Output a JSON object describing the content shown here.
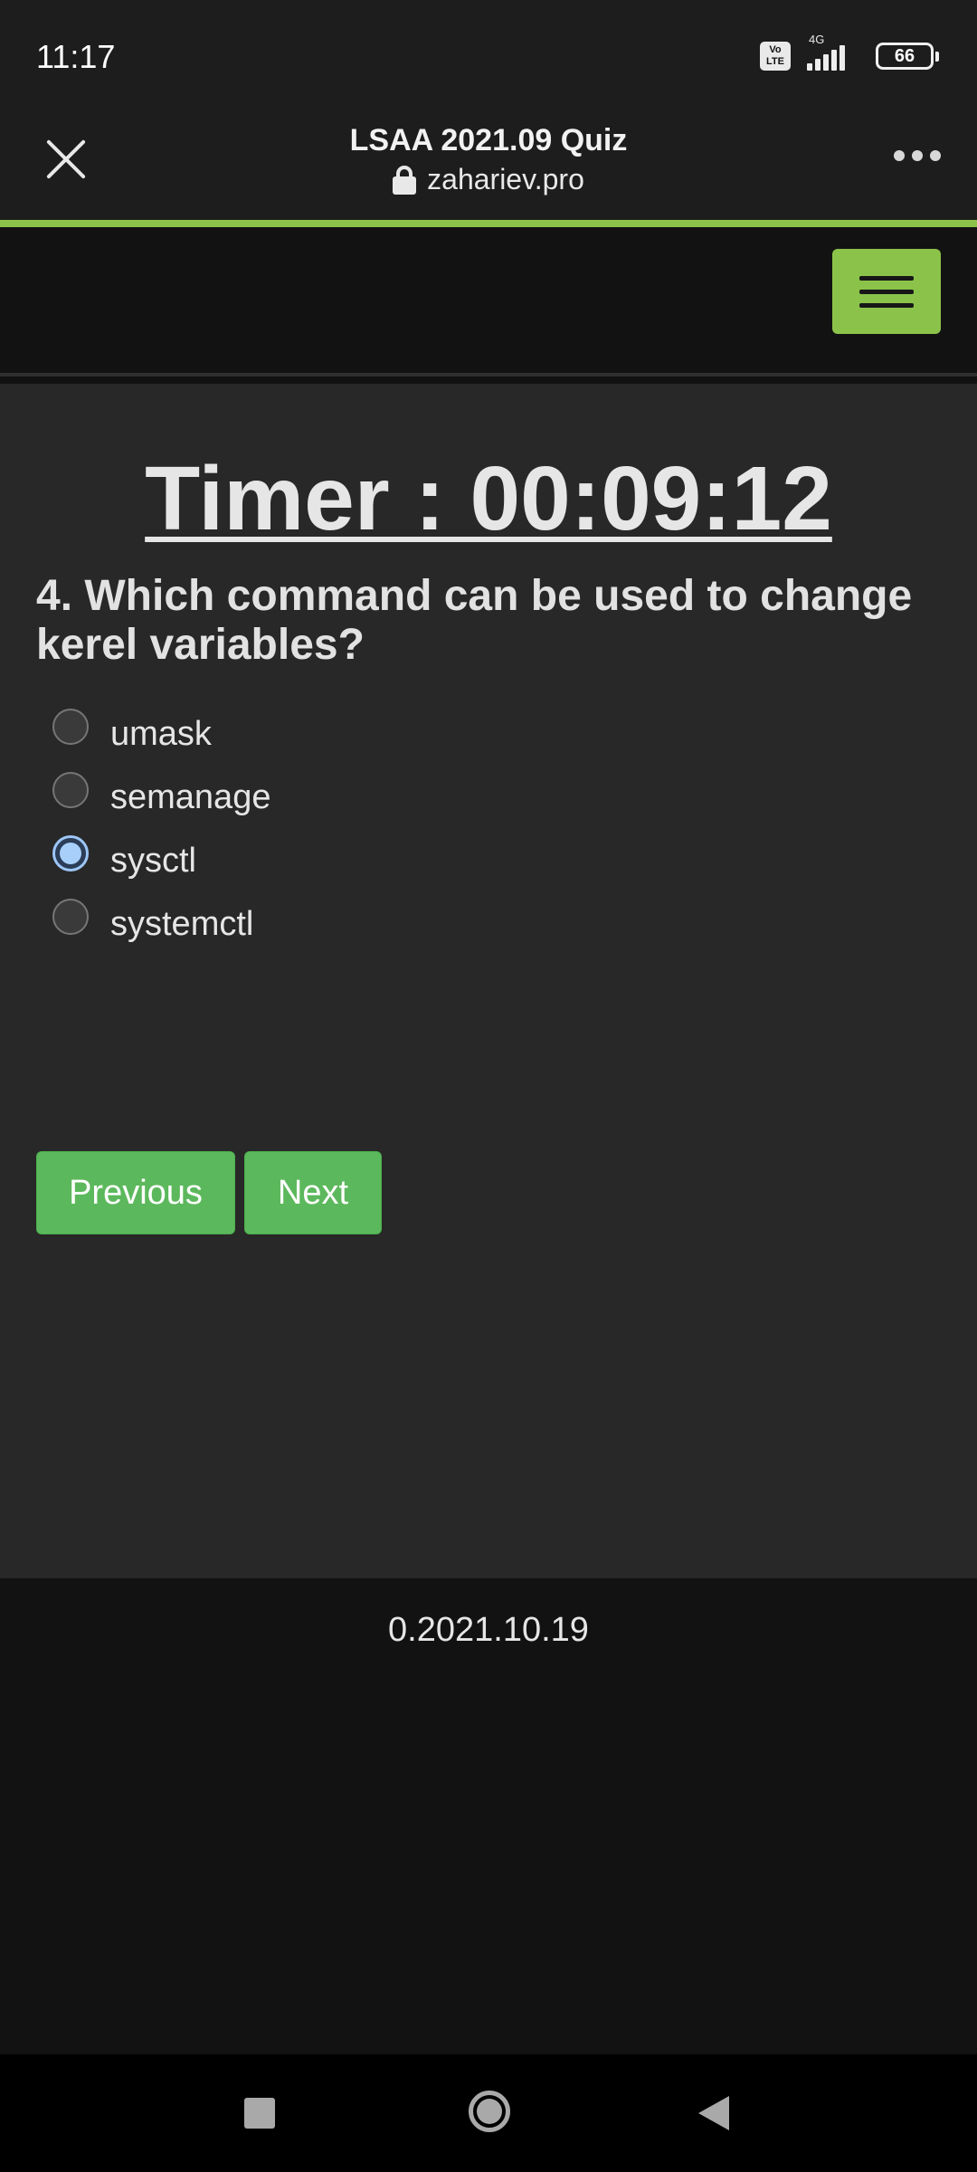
{
  "status_bar": {
    "time": "11:17",
    "volte_label": "Vo LTE",
    "network_type": "4G",
    "battery_level": "66"
  },
  "browser": {
    "page_title": "LSAA 2021.09 Quiz",
    "url": "zahariev.pro",
    "accent_color": "#8bc34a"
  },
  "quiz": {
    "timer": "Timer : 00:09:12",
    "question": "4. Which command can be used to change kerel variables?",
    "options": [
      {
        "label": "umask",
        "selected": false
      },
      {
        "label": "semanage",
        "selected": false
      },
      {
        "label": "sysctl",
        "selected": true
      },
      {
        "label": "systemctl",
        "selected": false
      }
    ],
    "previous_label": "Previous",
    "next_label": "Next",
    "button_color": "#5cb85c"
  },
  "footer": {
    "version": "0.2021.10.19"
  }
}
